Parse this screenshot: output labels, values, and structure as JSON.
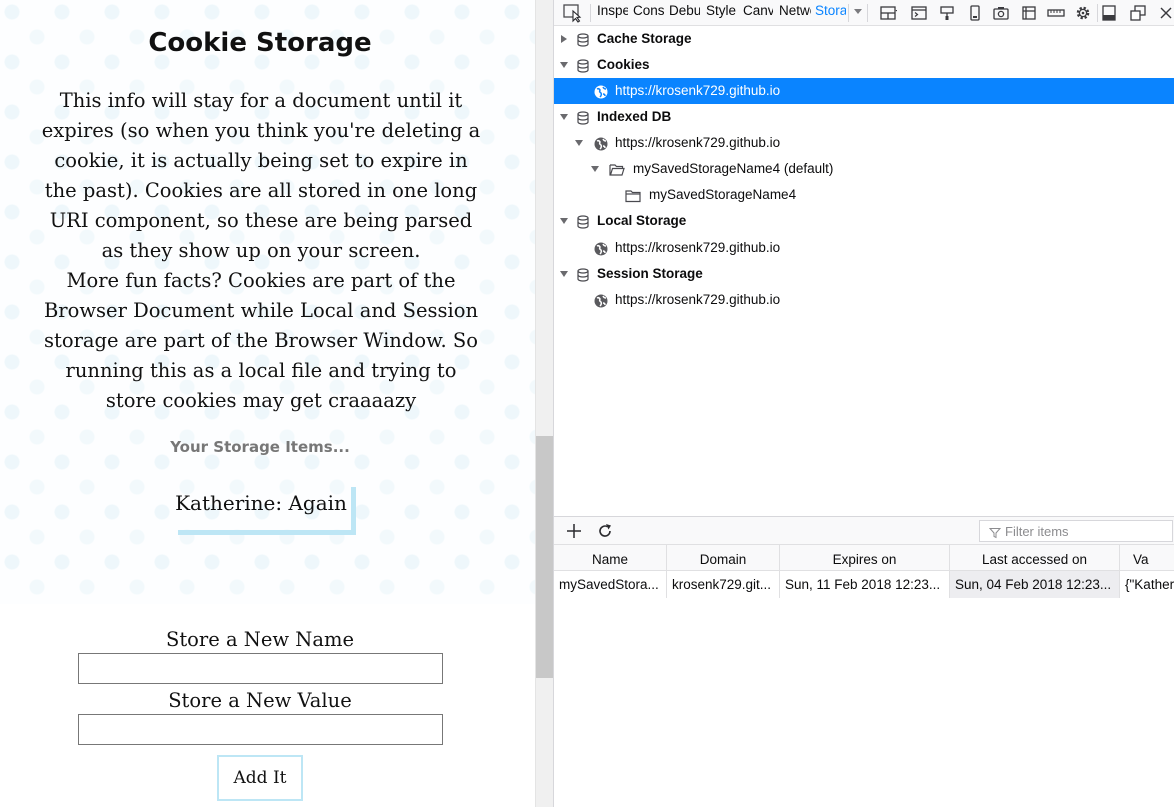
{
  "page": {
    "title": "Cookie Storage",
    "info_paragraphs": [
      "This info will stay for a document until it expires (so when you think you're deleting a cookie, it is actually being set to expire in the past). Cookies are all stored in one long URI component, so these are being parsed as they show up on your screen.",
      "More fun facts? Cookies are part of the Browser Document while Local and Session storage are part of the Browser Window. So running this as a local file and trying to store cookies may get craaaazy"
    ],
    "storage_items_heading": "Your Storage Items...",
    "storage_items": [
      "Katherine: Again"
    ],
    "form": {
      "name_label": "Store a New Name",
      "name_value": "",
      "value_label": "Store a New Value",
      "value_value": "",
      "submit_label": "Add It"
    }
  },
  "devtools": {
    "tabs": [
      {
        "label": "Inspector"
      },
      {
        "label": "Console"
      },
      {
        "label": "Debugger"
      },
      {
        "label": "Style Editor"
      },
      {
        "label": "Canvas"
      },
      {
        "label": "Network"
      },
      {
        "label": "Storage",
        "active": true
      }
    ],
    "toolbar_icons": [
      "layout-icon",
      "console-split-icon",
      "paint-flashing-icon",
      "responsive-design-icon",
      "screenshot-icon",
      "scratchpad-icon",
      "ruler-icon",
      "settings-gear-icon",
      "dock-icon",
      "separate-window-icon"
    ],
    "tree": {
      "cache_storage": "Cache Storage",
      "cookies": "Cookies",
      "cookies_host": "https://krosenk729.github.io",
      "indexed_db": "Indexed DB",
      "indexed_db_host": "https://krosenk729.github.io",
      "indexed_db_database": "mySavedStorageName4 (default)",
      "indexed_db_store": "mySavedStorageName4",
      "local_storage": "Local Storage",
      "local_storage_host": "https://krosenk729.github.io",
      "session_storage": "Session Storage",
      "session_storage_host": "https://krosenk729.github.io"
    },
    "filter_placeholder": "Filter items",
    "table": {
      "columns": [
        "Name",
        "Domain",
        "Expires on",
        "Last accessed on",
        "Va"
      ],
      "rows": [
        {
          "name": "mySavedStora...",
          "domain": "krosenk729.git...",
          "expires": "Sun, 11 Feb 2018 12:23...",
          "last_accessed": "Sun, 04 Feb 2018 12:23...",
          "value": "{\"Kather"
        }
      ]
    },
    "colors": {
      "accent": "#0a84ff",
      "selection_bg": "#0a84ff",
      "sorted_column_bg": "#ededf0"
    }
  }
}
